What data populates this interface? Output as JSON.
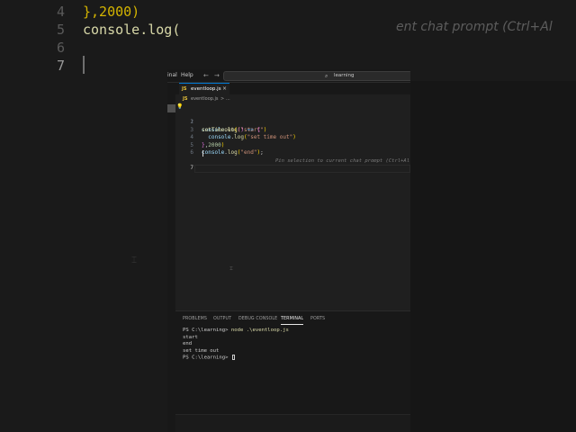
{
  "background": {
    "lines": [
      {
        "num": "4",
        "text": "},2000)"
      },
      {
        "num": "5",
        "text": "console.log("
      },
      {
        "num": "6",
        "text": ""
      },
      {
        "num": "7",
        "text": ""
      }
    ],
    "hint": "ent chat prompt (Ctrl+Al"
  },
  "titlebar": {
    "menu_terminal": "inal",
    "menu_help": "Help",
    "back_arrow": "←",
    "forward_arrow": "→",
    "search_icon": "⌕",
    "command_center": "learning"
  },
  "tab": {
    "badge": "JS",
    "label": "eventloop.js",
    "close": "×"
  },
  "breadcrumb": {
    "badge": "JS",
    "file": "eventloop.js",
    "sep": ">",
    "more": "..."
  },
  "editor": {
    "lines": [
      {
        "num": "1",
        "tokens": [
          [
            "tok-var",
            "console"
          ],
          [
            "tok-punc",
            "."
          ],
          [
            "tok-fn",
            "log"
          ],
          [
            "tok-br1",
            "("
          ],
          [
            "tok-str",
            "\"start\""
          ],
          [
            "tok-br1",
            ")"
          ]
        ]
      },
      {
        "num": "2",
        "tokens": [
          [
            "tok-fn",
            "setTimeout"
          ],
          [
            "tok-br1",
            "("
          ],
          [
            "tok-br2",
            "()"
          ],
          [
            "tok-punc",
            " "
          ],
          [
            "tok-kw",
            "=>"
          ],
          [
            "tok-punc",
            " "
          ],
          [
            "tok-br2",
            "{"
          ]
        ]
      },
      {
        "num": "3",
        "tokens": [
          [
            "tok-punc",
            "  "
          ],
          [
            "tok-var",
            "console"
          ],
          [
            "tok-punc",
            "."
          ],
          [
            "tok-fn",
            "log"
          ],
          [
            "tok-br1",
            "("
          ],
          [
            "tok-str",
            "\"set time out\""
          ],
          [
            "tok-br1",
            ")"
          ]
        ]
      },
      {
        "num": "4",
        "tokens": [
          [
            "tok-br2",
            "}"
          ],
          [
            "tok-punc",
            ","
          ],
          [
            "tok-num",
            "2000"
          ],
          [
            "tok-br1",
            ")"
          ]
        ]
      },
      {
        "num": "5",
        "tokens": [
          [
            "tok-var",
            "console"
          ],
          [
            "tok-punc",
            "."
          ],
          [
            "tok-fn",
            "log"
          ],
          [
            "tok-br1",
            "("
          ],
          [
            "tok-str",
            "\"end\""
          ],
          [
            "tok-br1",
            ")"
          ],
          [
            "tok-punc",
            ";"
          ]
        ]
      },
      {
        "num": "6",
        "tokens": []
      },
      {
        "num": "7",
        "tokens": []
      }
    ],
    "inline_hint": "Pin selection to current chat prompt (Ctrl+Al"
  },
  "panel": {
    "tabs": [
      "PROBLEMS",
      "OUTPUT",
      "DEBUG CONSOLE",
      "TERMINAL",
      "PORTS"
    ],
    "active_tab": "TERMINAL"
  },
  "terminal": {
    "prompt1": "PS C:\\learning> ",
    "command1": "node .\\eventloop.js",
    "output": [
      "start",
      "end",
      "set time out"
    ],
    "prompt2": "PS C:\\learning> "
  },
  "colors": {
    "accent": "#0078d4",
    "editor_bg": "#1f1f1f",
    "js_badge": "#e8c33b"
  }
}
